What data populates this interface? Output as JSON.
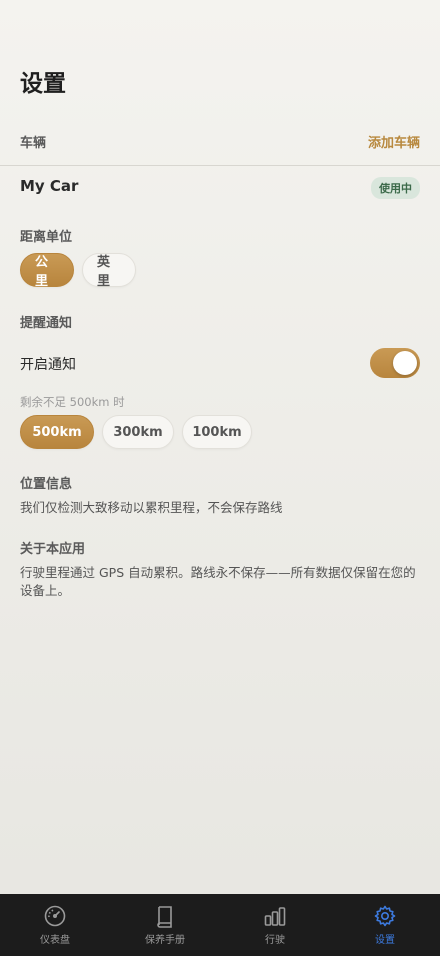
{
  "page": {
    "title": "设置"
  },
  "vehicles": {
    "section_label": "车辆",
    "add_label": "添加车辆",
    "items": [
      {
        "name": "My Car",
        "badge": "使用中"
      }
    ]
  },
  "distance_unit": {
    "section_label": "距离单位",
    "options": [
      "公里",
      "英里"
    ],
    "selected": "公里"
  },
  "reminders": {
    "section_label": "提醒通知",
    "toggle_label": "开启通知",
    "enabled": true,
    "threshold_label": "剩余不足 500km 时",
    "threshold_options": [
      "500km",
      "300km",
      "100km"
    ],
    "selected_threshold": "500km"
  },
  "location": {
    "section_label": "位置信息",
    "text": "我们仅检测大致移动以累积里程，不会保存路线"
  },
  "about": {
    "section_label": "关于本应用",
    "text": "行驶里程通过 GPS 自动累积。路线永不保存——所有数据仅保留在您的设备上。"
  },
  "tab_bar": {
    "tabs": [
      {
        "label": "仪表盘",
        "icon": "speedometer-icon"
      },
      {
        "label": "保养手册",
        "icon": "book-icon"
      },
      {
        "label": "行驶",
        "icon": "bar-chart-icon"
      },
      {
        "label": "设置",
        "icon": "gear-icon"
      }
    ],
    "active": "设置"
  },
  "colors": {
    "accent": "#b8853d",
    "badge_bg": "#d9e6dc",
    "tab_active": "#3d7be0",
    "tab_bar_bg": "#1c1c1c"
  }
}
